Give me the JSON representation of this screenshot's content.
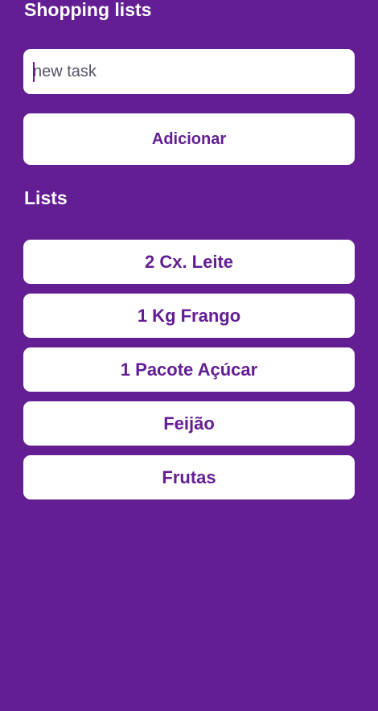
{
  "app": {
    "title": "Shopping lists"
  },
  "task_input": {
    "value": "",
    "placeholder": "new task"
  },
  "add_button": {
    "label": "Adicionar"
  },
  "lists_section": {
    "title": "Lists",
    "items": [
      "2 Cx. Leite",
      "1 Kg Frango",
      "1 Pacote Açúcar",
      "Feijão",
      "Frutas"
    ]
  },
  "colors": {
    "background": "#631e94",
    "card": "#ffffff",
    "accent_text": "#631e94"
  }
}
